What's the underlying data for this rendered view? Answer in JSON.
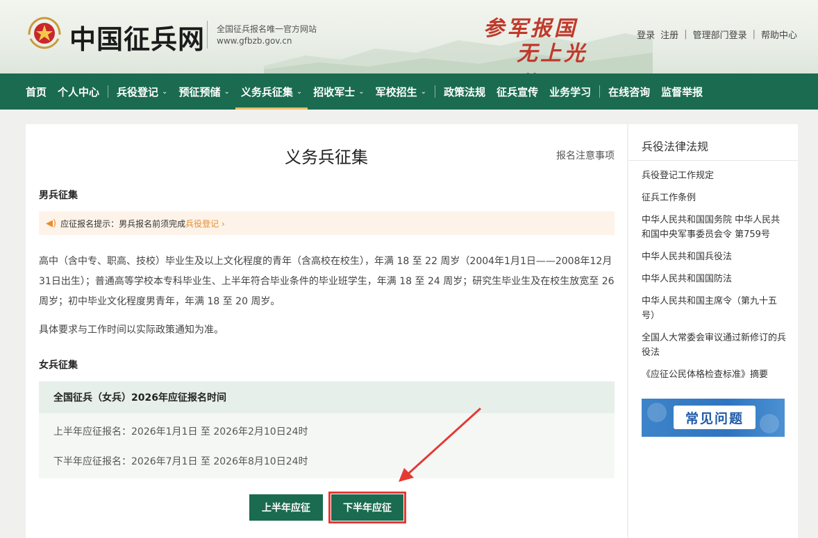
{
  "header": {
    "site_name": "中国征兵网",
    "slogan": "全国征兵报名唯一官方网站",
    "url": "www.gfbzb.gov.cn",
    "calligraphy_line1": "参军报国",
    "calligraphy_line2": "无上光荣",
    "links": [
      "登录",
      "注册",
      "管理部门登录",
      "帮助中心"
    ]
  },
  "nav": {
    "items": [
      {
        "label": "首页",
        "dropdown": false
      },
      {
        "label": "个人中心",
        "dropdown": false
      },
      {
        "label": "兵役登记",
        "dropdown": true
      },
      {
        "label": "预征预储",
        "dropdown": true
      },
      {
        "label": "义务兵征集",
        "dropdown": true,
        "active": true
      },
      {
        "label": "招收军士",
        "dropdown": true
      },
      {
        "label": "军校招生",
        "dropdown": true
      },
      {
        "label": "政策法规",
        "dropdown": false
      },
      {
        "label": "征兵宣传",
        "dropdown": false
      },
      {
        "label": "业务学习",
        "dropdown": false
      },
      {
        "label": "在线咨询",
        "dropdown": false
      },
      {
        "label": "监督举报",
        "dropdown": false
      }
    ],
    "chevron": "⌄"
  },
  "main": {
    "title": "义务兵征集",
    "notice_link": "报名注意事项",
    "male_title": "男兵征集",
    "tip_prefix": "应征报名提示：男兵报名前须完成",
    "tip_link": "兵役登记",
    "tip_arrow": "›",
    "male_para1": "高中（含中专、职高、技校）毕业生及以上文化程度的青年（含高校在校生），年满 18 至 22 周岁（2004年1月1日——2008年12月31日出生）；普通高等学校本专科毕业生、上半年符合毕业条件的毕业班学生，年满 18 至 24 周岁；研究生毕业生及在校生放宽至 26 周岁；初中毕业文化程度男青年，年满 18 至 20 周岁。",
    "male_para2": "具体要求与工作时间以实际政策通知为准。",
    "female_title": "女兵征集",
    "period_head": "全国征兵（女兵）2026年应征报名时间",
    "first_half": "上半年应征报名：2026年1月1日 至 2026年2月10日24时",
    "second_half": "下半年应征报名：2026年7月1日 至 2026年8月10日24时",
    "btn_first": "上半年应征",
    "btn_second": "下半年应征"
  },
  "sidebar": {
    "title": "兵役法律法规",
    "items": [
      "兵役登记工作规定",
      "征兵工作条例",
      "中华人民共和国国务院 中华人民共和国中央军事委员会令 第759号",
      "中华人民共和国兵役法",
      "中华人民共和国国防法",
      "中华人民共和国主席令（第九十五号）",
      "全国人大常委会审议通过新修订的兵役法",
      "《应征公民体格检查标准》摘要"
    ],
    "faq_label": "常见问题"
  },
  "colors": {
    "nav_green": "#1a6b4f",
    "accent_orange": "#e98b2a",
    "highlight_red": "#e53935",
    "calligraphy_red": "#c0392b"
  }
}
